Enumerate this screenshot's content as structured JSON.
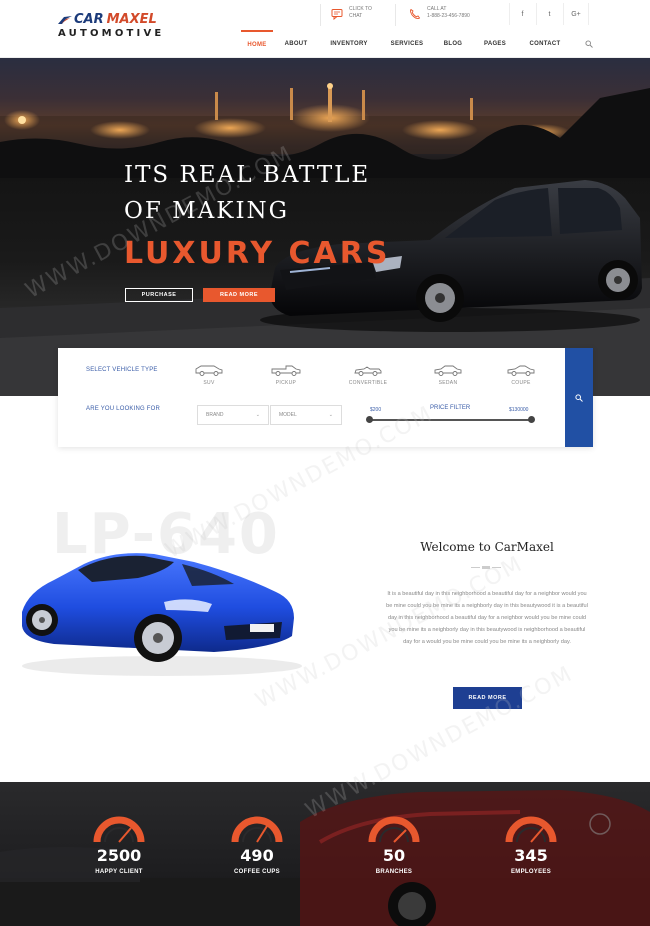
{
  "brand": {
    "name_part1": "CAR",
    "name_part2": "MAXEL",
    "tagline": "AUTOMOTIVE"
  },
  "header": {
    "chat": {
      "line1": "CLICK TO",
      "line2": "CHAT"
    },
    "call": {
      "line1": "CALL AT",
      "line2": "1-888-23-456-7890"
    },
    "social": {
      "facebook": "f",
      "twitter": "t",
      "google": "G+"
    }
  },
  "nav": {
    "items": [
      "HOME",
      "ABOUT",
      "INVENTORY",
      "SERVICES",
      "BLOG",
      "PAGES",
      "CONTACT"
    ],
    "active": "HOME"
  },
  "hero": {
    "line1": "ITS REAL BATTLE",
    "line2": "OF MAKING",
    "accent": "LUXURY CARS",
    "purchase_label": "PURCHASE",
    "read_more_label": "READ MORE"
  },
  "search": {
    "vehicle_type_label": "SELECT VEHICLE TYPE",
    "looking_for_label": "ARE YOU LOOKING FOR",
    "vehicles": [
      "SUV",
      "PICKUP",
      "CONVERTIBLE",
      "SEDAN",
      "COUPE"
    ],
    "brand_placeholder": "BRAND",
    "model_placeholder": "MODEL",
    "price_filter_label": "PRICE FILTER",
    "price_min": "$200",
    "price_max": "$130000"
  },
  "welcome": {
    "ghost": "LP-640",
    "title": "Welcome to CarMaxel",
    "body": "It is a beautiful day in this neighborhood a beautiful day for a neighbor would you be mine could you be mine its a neighborly day in this beautywood it is a beautiful day in this neighborhood a beautiful day for a neighbor would you be mine could you be mine its a neighborly day in this beautywood is neighborhood a beautiful day for a would you be mine could you be mine its a neighborly day.",
    "button_label": "READ MORE"
  },
  "stats": [
    {
      "value": "2500",
      "label": "HAPPY CLIENT"
    },
    {
      "value": "490",
      "label": "COFFEE CUPS"
    },
    {
      "value": "50",
      "label": "BRANCHES"
    },
    {
      "value": "345",
      "label": "EMPLOYEES"
    }
  ],
  "watermark": "WWW.DOWNDEMO.COM",
  "colors": {
    "accent": "#e8582e",
    "primary": "#2150a4",
    "dark_blue": "#1e3f92"
  }
}
